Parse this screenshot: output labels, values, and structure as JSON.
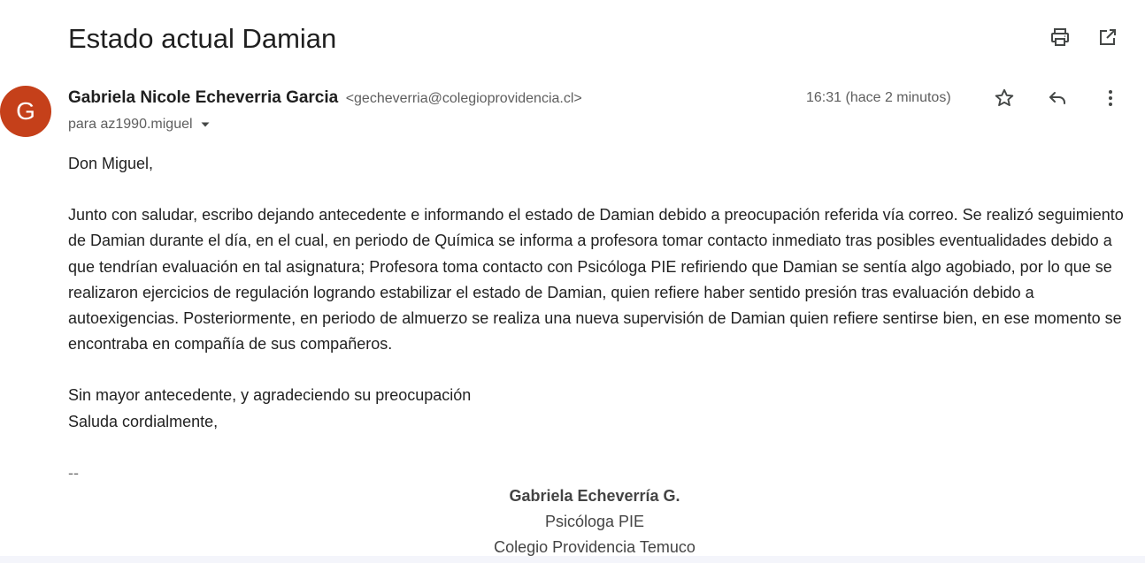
{
  "email": {
    "subject": "Estado actual Damian",
    "sender_name": "Gabriela Nicole Echeverria Garcia",
    "sender_email": "<gecheverria@colegioprovidencia.cl>",
    "avatar_letter": "G",
    "recipient": "para az1990.miguel",
    "timestamp": "16:31 (hace 2 minutos)",
    "greeting": "Don Miguel,",
    "paragraph": "Junto con saludar, escribo dejando antecedente e informando el estado de Damian debido a preocupación referida vía correo. Se realizó seguimiento de Damian durante el día, en el cual, en periodo de Química se informa a profesora tomar contacto inmediato tras posibles eventualidades debido a que tendrían evaluación en tal asignatura; Profesora toma contacto con Psicóloga PIE refiriendo que Damian se sentía algo agobiado, por lo que se realizaron ejercicios de regulación logrando estabilizar el estado de Damian, quien refiere haber sentido presión tras evaluación debido a autoexigencias. Posteriormente, en periodo de almuerzo se realiza una nueva supervisión de Damian quien refiere sentirse bien, en ese momento se encontraba en compañía de sus compañeros.",
    "closing_1": "Sin mayor antecedente, y agradeciendo su preocupación",
    "closing_2": "Saluda cordialmente,",
    "signature_separator": "--",
    "signature": {
      "name": "Gabriela Echeverría G.",
      "role": "Psicóloga PIE",
      "organization": "Colegio Providencia Temuco"
    }
  },
  "icons": {
    "print": "print-icon",
    "open_new_window": "open-in-new-window-icon",
    "star": "star-icon",
    "reply": "reply-icon",
    "more": "more-vertical-icon",
    "recipient_dropdown": "chevron-down-icon"
  },
  "colors": {
    "avatar_bg": "#c5401a",
    "text_primary": "#1f1f1f",
    "text_secondary": "#5e5e5e"
  }
}
